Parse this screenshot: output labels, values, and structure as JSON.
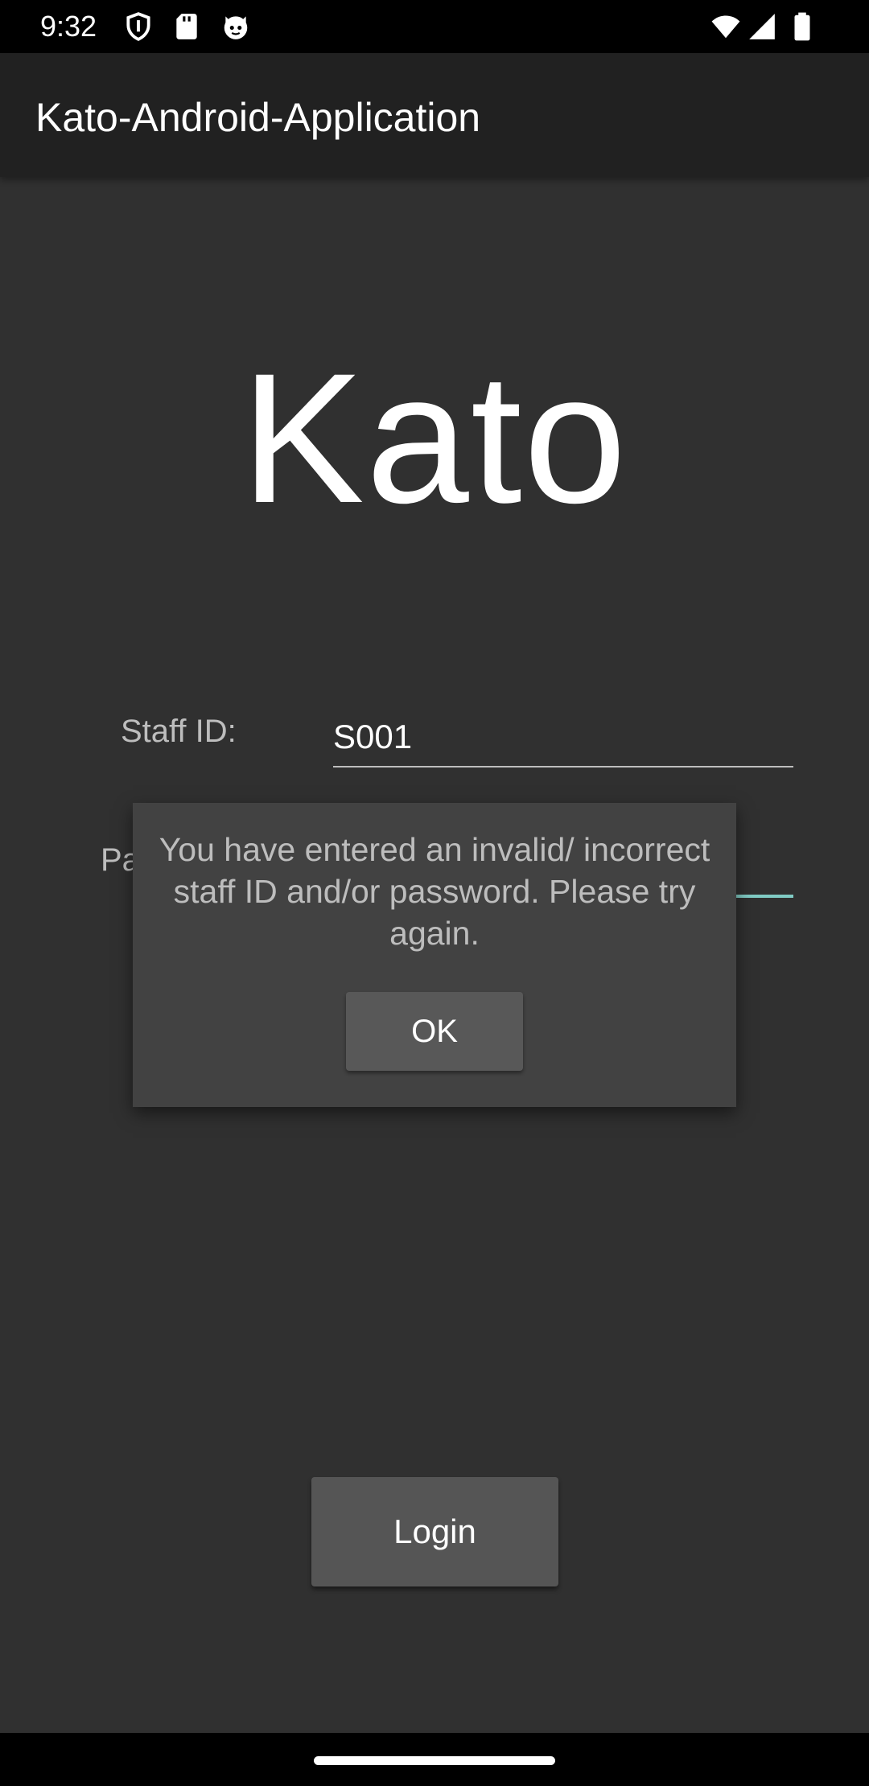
{
  "status_bar": {
    "time": "9:32",
    "icons_left": [
      "shield-icon",
      "sd-card-icon",
      "cat-face-icon"
    ],
    "icons_right": [
      "wifi-icon",
      "signal-icon",
      "battery-icon"
    ]
  },
  "app_bar": {
    "title": "Kato-Android-Application"
  },
  "main": {
    "logo": "Kato",
    "staff_id_label": "Staff ID:",
    "staff_id_value": "S001",
    "password_label_partial": "Pa",
    "login_label": "Login"
  },
  "dialog": {
    "message": "You have entered an invalid/ incorrect staff ID and/or password. Please try again.",
    "ok_label": "OK"
  },
  "colors": {
    "background": "#303030",
    "app_bar": "#212121",
    "accent": "#80cbc4",
    "dialog": "#424242",
    "button": "#555555"
  }
}
